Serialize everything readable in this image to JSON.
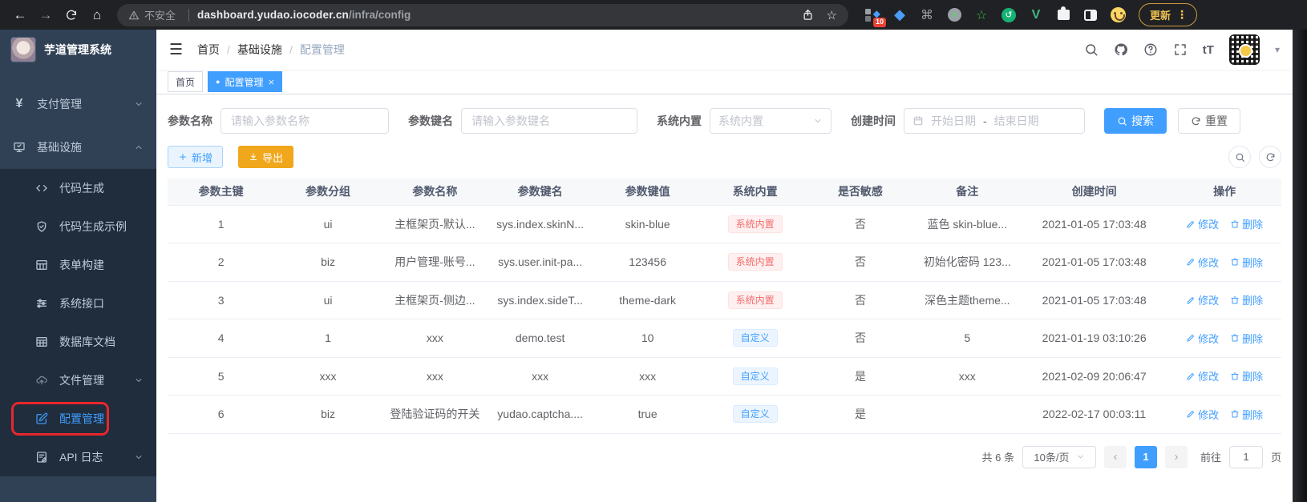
{
  "browser": {
    "security": "不安全",
    "url_host": "dashboard.yudao.iocoder.cn",
    "url_path": "/infra/config",
    "ext_badge": "10",
    "update": "更新"
  },
  "app": {
    "title": "芋道管理系统"
  },
  "nav": {
    "breadcrumb": [
      "首页",
      "基础设施",
      "配置管理"
    ]
  },
  "tabs": {
    "home": "首页",
    "active": "配置管理"
  },
  "sidebar": {
    "items": [
      {
        "label": "支付管理"
      },
      {
        "label": "基础设施"
      },
      {
        "label": "代码生成"
      },
      {
        "label": "代码生成示例"
      },
      {
        "label": "表单构建"
      },
      {
        "label": "系统接口"
      },
      {
        "label": "数据库文档"
      },
      {
        "label": "文件管理"
      },
      {
        "label": "配置管理"
      },
      {
        "label": "API 日志"
      }
    ]
  },
  "filters": {
    "name_label": "参数名称",
    "name_placeholder": "请输入参数名称",
    "key_label": "参数键名",
    "key_placeholder": "请输入参数键名",
    "builtin_label": "系统内置",
    "builtin_placeholder": "系统内置",
    "date_label": "创建时间",
    "date_start": "开始日期",
    "date_sep": "-",
    "date_end": "结束日期",
    "search": "搜索",
    "reset": "重置"
  },
  "toolbar": {
    "add": "新增",
    "export": "导出"
  },
  "table": {
    "headers": [
      "参数主键",
      "参数分组",
      "参数名称",
      "参数键名",
      "参数键值",
      "系统内置",
      "是否敏感",
      "备注",
      "创建时间",
      "操作"
    ],
    "edit": "修改",
    "delete": "删除",
    "rows": [
      {
        "id": "1",
        "group": "ui",
        "name": "主框架页-默认...",
        "key": "sys.index.skinN...",
        "value": "skin-blue",
        "builtin": "系统内置",
        "sensitive": "否",
        "remark": "蓝色 skin-blue...",
        "created": "2021-01-05 17:03:48"
      },
      {
        "id": "2",
        "group": "biz",
        "name": "用户管理-账号...",
        "key": "sys.user.init-pa...",
        "value": "123456",
        "builtin": "系统内置",
        "sensitive": "否",
        "remark": "初始化密码 123...",
        "created": "2021-01-05 17:03:48"
      },
      {
        "id": "3",
        "group": "ui",
        "name": "主框架页-侧边...",
        "key": "sys.index.sideT...",
        "value": "theme-dark",
        "builtin": "系统内置",
        "sensitive": "否",
        "remark": "深色主题theme...",
        "created": "2021-01-05 17:03:48"
      },
      {
        "id": "4",
        "group": "1",
        "name": "xxx",
        "key": "demo.test",
        "value": "10",
        "builtin": "自定义",
        "sensitive": "否",
        "remark": "5",
        "created": "2021-01-19 03:10:26"
      },
      {
        "id": "5",
        "group": "xxx",
        "name": "xxx",
        "key": "xxx",
        "value": "xxx",
        "builtin": "自定义",
        "sensitive": "是",
        "remark": "xxx",
        "created": "2021-02-09 20:06:47"
      },
      {
        "id": "6",
        "group": "biz",
        "name": "登陆验证码的开关",
        "key": "yudao.captcha....",
        "value": "true",
        "builtin": "自定义",
        "sensitive": "是",
        "remark": "",
        "created": "2022-02-17 00:03:11"
      }
    ]
  },
  "pagination": {
    "total": "共 6 条",
    "size": "10条/页",
    "page": "1",
    "goto": "前往",
    "goto_value": "1",
    "unit": "页"
  },
  "colors": {
    "accent": "#409eff",
    "danger": "#f56c6c",
    "warning": "#f0a71c",
    "annotation": "#e8262d",
    "sidebar": "#304156"
  },
  "glyphs": {
    "back": "←",
    "forward": "→",
    "home": "⌂",
    "star": "☆",
    "hamburger": "☰",
    "caret": "▾",
    "dots": "⋮",
    "close": "×",
    "dot": "●",
    "yen": "¥",
    "command": "⌘",
    "vue": "V",
    "diamond": "◆",
    "cycle": "↺",
    "font_size": "tT",
    "prev": "‹",
    "next": "›"
  }
}
